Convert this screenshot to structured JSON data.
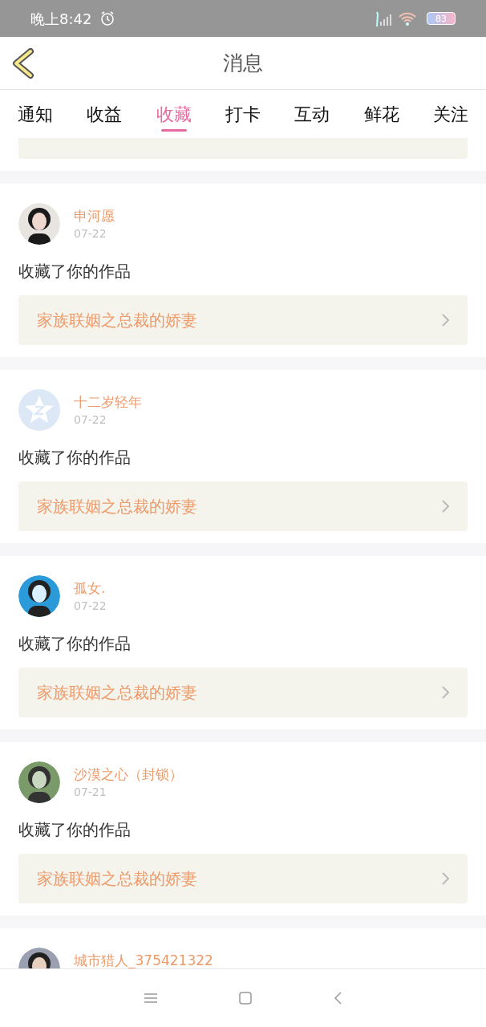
{
  "status_bar": {
    "time": "晚上8:42",
    "battery": "83"
  },
  "header": {
    "title": "消息"
  },
  "tabs": [
    {
      "label": "通知",
      "selected": false
    },
    {
      "label": "收益",
      "selected": false
    },
    {
      "label": "收藏",
      "selected": true
    },
    {
      "label": "打卡",
      "selected": false
    },
    {
      "label": "互动",
      "selected": false
    },
    {
      "label": "鲜花",
      "selected": false
    },
    {
      "label": "关注",
      "selected": false
    }
  ],
  "messages": [
    {
      "user": "申河愿",
      "date": "07-22",
      "action": "收藏了你的作品",
      "work": "家族联姻之总裁的娇妻"
    },
    {
      "kind": "default",
      "user": "十二岁轻年",
      "date": "07-22",
      "action": "收藏了你的作品",
      "work": "家族联姻之总裁的娇妻"
    },
    {
      "user": "孤女.",
      "date": "07-22",
      "action": "收藏了你的作品",
      "work": "家族联姻之总裁的娇妻"
    },
    {
      "user": "沙漠之心（封锁）",
      "date": "07-21",
      "action": "收藏了你的作品",
      "work": "家族联姻之总裁的娇妻"
    },
    {
      "user": "城市猎人_375421322"
    }
  ]
}
